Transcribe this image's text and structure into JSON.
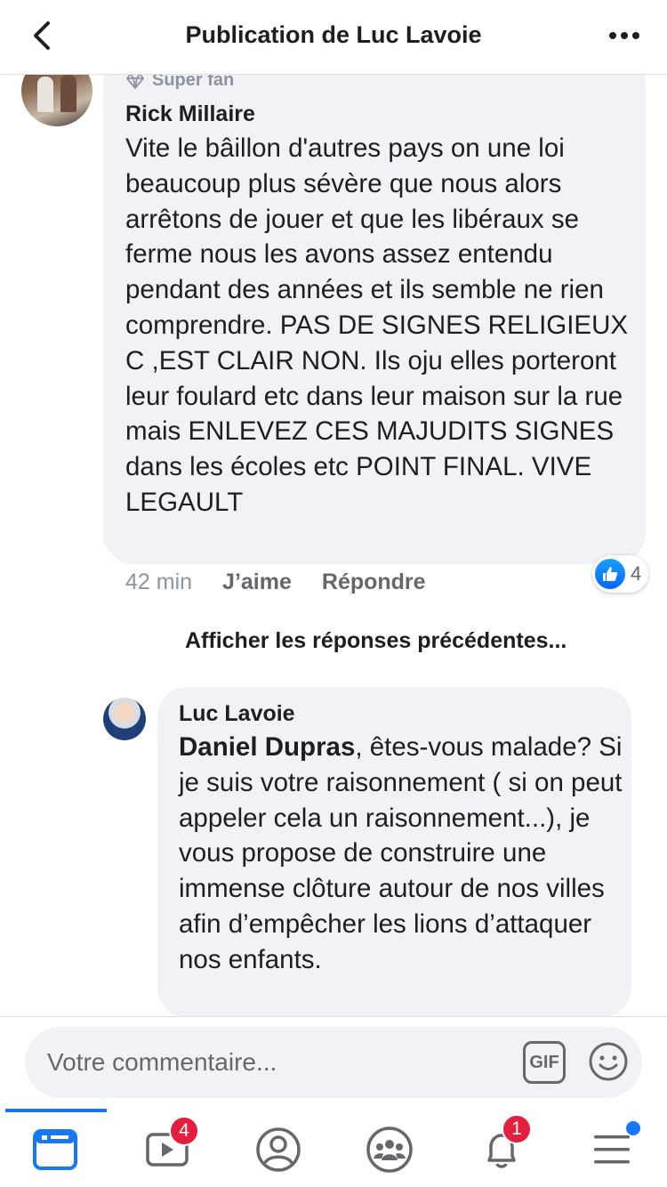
{
  "header": {
    "title": "Publication de Luc Lavoie",
    "back_icon": "chevron-left-icon",
    "more_icon": "more-horizontal-icon"
  },
  "comments": [
    {
      "badge": "Super fan",
      "author": "Rick Millaire",
      "text": "Vite le bâillon d'autres pays on une loi beaucoup plus sévère que nous alors arrêtons de jouer et que les libéraux se ferme nous les avons assez entendu pendant des années et ils semble ne rien comprendre. PAS DE SIGNES RELIGIEUX C ,EST CLAIR NON. Ils oju elles porteront leur foulard etc dans leur maison sur la rue mais ENLEVEZ CES MAJUDITS SIGNES dans les écoles etc POINT FINAL. VIVE LEGAULT",
      "time": "42 min",
      "like_label": "J’aime",
      "reply_label": "Répondre",
      "reaction_count": "4"
    }
  ],
  "previous_replies_label": "Afficher les réponses précédentes...",
  "reply": {
    "author": "Luc Lavoie",
    "mention": "Daniel Dupras",
    "text": ", êtes-vous malade? Si je suis votre raisonnement ( si on peut appeler cela un raisonnement...), je vous propose de construire une immense clôture autour de nos villes afin d’empêcher les lions d’attaquer nos enfants."
  },
  "composer": {
    "placeholder": "Votre commentaire...",
    "gif_label": "GIF"
  },
  "tabbar": {
    "video_badge": "4",
    "notifications_badge": "1"
  },
  "colors": {
    "accent": "#1877f2",
    "badge_red": "#e41e3f",
    "bubble_bg": "#f0f2f5"
  }
}
